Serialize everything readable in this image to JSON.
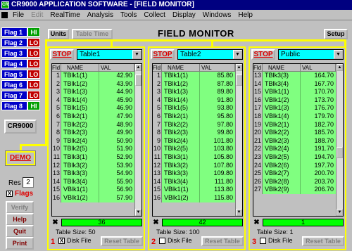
{
  "title": "CR9000 APPLICATION SOFTWARE - [FIELD MONITOR]",
  "app_icon_text": "CR",
  "menu": [
    "File",
    "Edit",
    "RealTime",
    "Analysis",
    "Tools",
    "Collect",
    "Display",
    "Windows",
    "Help"
  ],
  "flags": [
    {
      "label": "Flag 1",
      "state": "HI"
    },
    {
      "label": "Flag 2",
      "state": "LO"
    },
    {
      "label": "Flag 3",
      "state": "LO"
    },
    {
      "label": "Flag 4",
      "state": "LO"
    },
    {
      "label": "Flag 5",
      "state": "LO"
    },
    {
      "label": "Flag 6",
      "state": "LO"
    },
    {
      "label": "Flag 7",
      "state": "LO"
    },
    {
      "label": "Flag 8",
      "state": "HI"
    }
  ],
  "sidebar": {
    "cr9000": "CR9000",
    "demo": "DEMO",
    "res_label": "Res",
    "res_value": "2",
    "flags_check": "X",
    "flags_label": "Flags",
    "verify": "Verify",
    "help": "Help",
    "quit": "Quit",
    "print": "Print"
  },
  "header": {
    "units": "Units",
    "table_time": "Table Time",
    "title": "FIELD MONITOR",
    "setup": "Setup"
  },
  "col_headers": {
    "fld": "Fld",
    "name": "NAME",
    "val": "VAL"
  },
  "panels": [
    {
      "stop": "STOP",
      "table": "Table1",
      "count": "36",
      "size": "Table Size: 50",
      "num": "1",
      "disk_check": "X",
      "disk": "Disk File",
      "reset": "Reset Table",
      "thumb": 0.03,
      "rows": [
        [
          "1",
          "TBlk1(1)",
          "42.90"
        ],
        [
          "2",
          "TBlk1(2)",
          "43.90"
        ],
        [
          "3",
          "TBlk1(3)",
          "44.90"
        ],
        [
          "4",
          "TBlk1(4)",
          "45.90"
        ],
        [
          "5",
          "TBlk1(5)",
          "46.90"
        ],
        [
          "6",
          "TBlk2(1)",
          "47.90"
        ],
        [
          "7",
          "TBlk2(2)",
          "48.90"
        ],
        [
          "8",
          "TBlk2(3)",
          "49.90"
        ],
        [
          "9",
          "TBlk2(4)",
          "50.90"
        ],
        [
          "10",
          "TBlk2(5)",
          "51.90"
        ],
        [
          "11",
          "TBlk3(1)",
          "52.90"
        ],
        [
          "12",
          "TBlk3(2)",
          "53.90"
        ],
        [
          "13",
          "TBlk3(3)",
          "54.90"
        ],
        [
          "14",
          "TBlk3(4)",
          "55.90"
        ],
        [
          "15",
          "VBlk1(1)",
          "56.90"
        ],
        [
          "16",
          "VBlk1(2)",
          "57.90"
        ]
      ]
    },
    {
      "stop": "STOP",
      "table": "Table2",
      "count": "42",
      "size": "Table Size: 100",
      "num": "2",
      "disk_check": "",
      "disk": "Disk File",
      "reset": "Reset Table",
      "thumb": 0.03,
      "rows": [
        [
          "1",
          "TBlk1(1)",
          "85.80"
        ],
        [
          "2",
          "TBlk1(2)",
          "87.80"
        ],
        [
          "3",
          "TBlk1(3)",
          "89.80"
        ],
        [
          "4",
          "TBlk1(4)",
          "91.80"
        ],
        [
          "5",
          "TBlk1(5)",
          "93.80"
        ],
        [
          "6",
          "TBlk2(1)",
          "95.80"
        ],
        [
          "7",
          "TBlk2(2)",
          "97.80"
        ],
        [
          "8",
          "TBlk2(3)",
          "99.80"
        ],
        [
          "9",
          "TBlk2(4)",
          "101.80"
        ],
        [
          "10",
          "TBlk2(5)",
          "103.80"
        ],
        [
          "11",
          "TBlk3(1)",
          "105.80"
        ],
        [
          "12",
          "TBlk3(2)",
          "107.80"
        ],
        [
          "13",
          "TBlk3(3)",
          "109.80"
        ],
        [
          "14",
          "TBlk3(4)",
          "111.80"
        ],
        [
          "15",
          "VBlk1(1)",
          "113.80"
        ],
        [
          "16",
          "VBlk1(2)",
          "115.80"
        ]
      ]
    },
    {
      "stop": "STOP",
      "table": "Public",
      "count": "1",
      "size": "Table Size: 1",
      "num": "3",
      "disk_check": "",
      "disk": "Disk File",
      "reset": "Reset Table",
      "thumb": 0.6,
      "rows": [
        [
          "13",
          "TBlk3(3)",
          "164.70"
        ],
        [
          "14",
          "TBlk3(4)",
          "167.70"
        ],
        [
          "15",
          "VBlk1(1)",
          "170.70"
        ],
        [
          "16",
          "VBlk1(2)",
          "173.70"
        ],
        [
          "17",
          "VBlk1(3)",
          "176.70"
        ],
        [
          "18",
          "VBlk1(4)",
          "179.70"
        ],
        [
          "19",
          "VBlk2(1)",
          "182.70"
        ],
        [
          "20",
          "VBlk2(2)",
          "185.70"
        ],
        [
          "21",
          "VBlk2(3)",
          "188.70"
        ],
        [
          "22",
          "VBlk2(4)",
          "191.70"
        ],
        [
          "23",
          "VBlk2(5)",
          "194.70"
        ],
        [
          "24",
          "VBlk2(6)",
          "197.70"
        ],
        [
          "25",
          "VBlk2(7)",
          "200.70"
        ],
        [
          "26",
          "VBlk2(8)",
          "203.70"
        ],
        [
          "27",
          "VBlk2(9)",
          "206.70"
        ]
      ]
    }
  ]
}
